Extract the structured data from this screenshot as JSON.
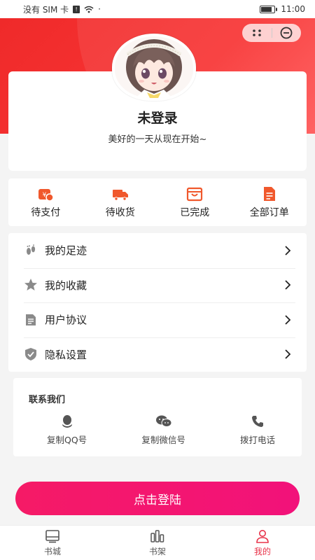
{
  "status_bar": {
    "carrier": "没有 SIM 卡",
    "sim_badge": "!",
    "dot": "·",
    "battery_level": 0.85,
    "time": "11:00"
  },
  "capsule": {
    "more_icon": "more-dots-icon",
    "close_icon": "minus-circle-icon"
  },
  "profile": {
    "title": "未登录",
    "slogan": "美好的一天从现在开始~"
  },
  "orders": [
    {
      "label": "待支付",
      "icon": "yen-wallet-icon"
    },
    {
      "label": "待收货",
      "icon": "truck-icon"
    },
    {
      "label": "已完成",
      "icon": "bag-icon"
    },
    {
      "label": "全部订单",
      "icon": "document-icon"
    }
  ],
  "menu": [
    {
      "label": "我的足迹",
      "icon": "footprint-icon"
    },
    {
      "label": "我的收藏",
      "icon": "star-icon"
    },
    {
      "label": "用户协议",
      "icon": "document-icon"
    },
    {
      "label": "隐私设置",
      "icon": "shield-check-icon"
    }
  ],
  "contact": {
    "title": "联系我们",
    "items": [
      {
        "label": "复制QQ号",
        "icon": "qq-icon"
      },
      {
        "label": "复制微信号",
        "icon": "wechat-icon"
      },
      {
        "label": "拨打电话",
        "icon": "phone-icon"
      }
    ]
  },
  "login_button": "点击登陆",
  "tabs": [
    {
      "label": "书城",
      "icon": "bookstore-icon"
    },
    {
      "label": "书架",
      "icon": "bookshelf-icon"
    },
    {
      "label": "我的",
      "icon": "user-icon"
    }
  ],
  "colors": {
    "header_red": "#f23030",
    "accent_pink": "#f5196a",
    "order_icon_orange": "#f0582c",
    "active_tab": "#e8334a",
    "menu_icon_gray": "#8a8a8a"
  }
}
